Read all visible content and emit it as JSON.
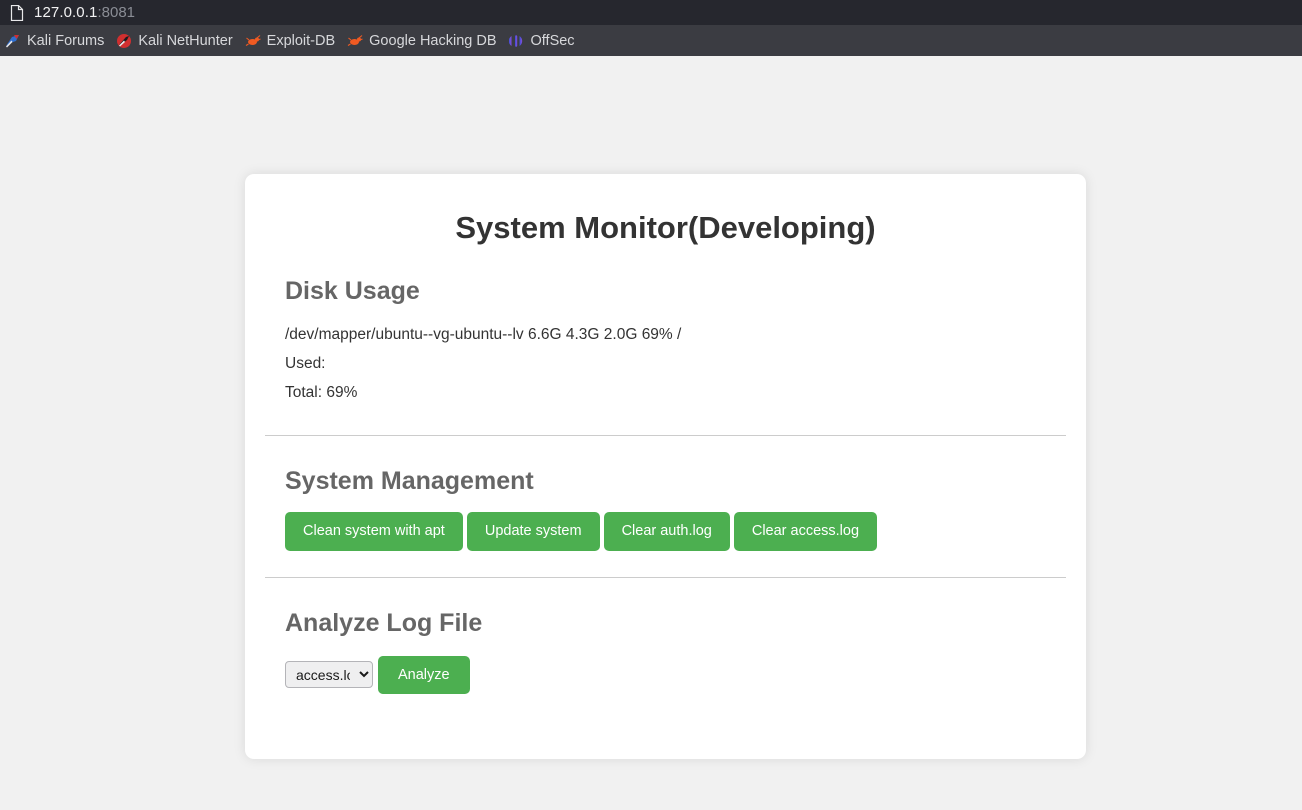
{
  "browser": {
    "url": {
      "icon": "page-icon",
      "host": "127.0.0.1",
      "port": ":8081"
    },
    "bookmarks": [
      {
        "icon": "kali-forums-icon",
        "label": "Kali Forums"
      },
      {
        "icon": "kali-nethunter-icon",
        "label": "Kali NetHunter"
      },
      {
        "icon": "exploit-db-icon",
        "label": "Exploit-DB"
      },
      {
        "icon": "google-hacking-db-icon",
        "label": "Google Hacking DB"
      },
      {
        "icon": "offsec-icon",
        "label": "OffSec"
      }
    ]
  },
  "page": {
    "title": "System Monitor(Developing)",
    "disk_usage": {
      "heading": "Disk Usage",
      "device_line": "/dev/mapper/ubuntu--vg-ubuntu--lv 6.6G 4.3G 2.0G 69% /",
      "used_label": "Used:",
      "total_label": "Total: 69%"
    },
    "system_management": {
      "heading": "System Management",
      "buttons": [
        "Clean system with apt",
        "Update system",
        "Clear auth.log",
        "Clear access.log"
      ]
    },
    "analyze_log": {
      "heading": "Analyze Log File",
      "selected_log": "access.log",
      "options": [
        "access.log"
      ],
      "analyze_button": "Analyze"
    }
  },
  "colors": {
    "accent_green": "#4caf50",
    "page_background": "#f1f1f1",
    "card_background": "#ffffff",
    "heading_gray": "#666666",
    "chrome_dark": "#26272e",
    "bookmarks_bar": "#3b3c42"
  }
}
